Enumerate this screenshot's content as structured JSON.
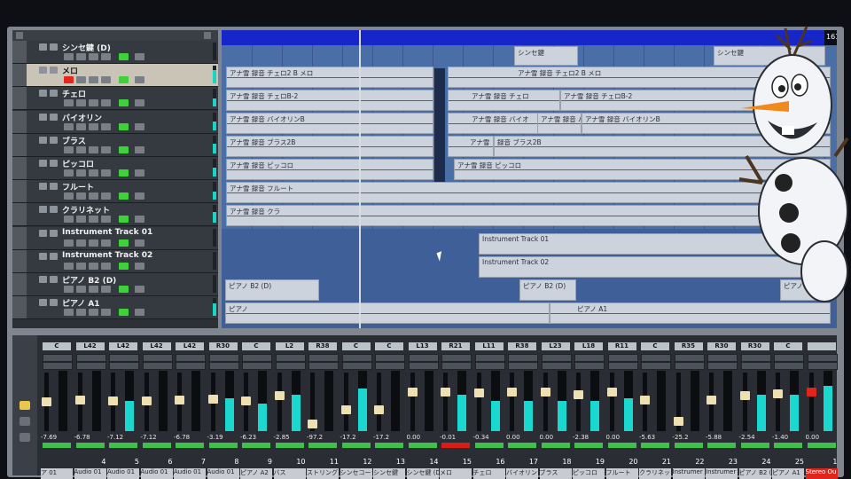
{
  "tracks": [
    {
      "name": "シンセ鍵 (D)",
      "selected": false,
      "rec": false,
      "meter": 0
    },
    {
      "name": "メロ",
      "selected": true,
      "rec": true,
      "meter": 0.75
    },
    {
      "name": "チェロ",
      "selected": false,
      "rec": false,
      "meter": 0.45
    },
    {
      "name": "バイオリン",
      "selected": false,
      "rec": false,
      "meter": 0.5
    },
    {
      "name": "ブラス",
      "selected": false,
      "rec": false,
      "meter": 0.55
    },
    {
      "name": "ピッコロ",
      "selected": false,
      "rec": false,
      "meter": 0.5
    },
    {
      "name": "フルート",
      "selected": false,
      "rec": false,
      "meter": 0.45
    },
    {
      "name": "クラリネット",
      "selected": false,
      "rec": false,
      "meter": 0.6
    },
    {
      "name": "Instrument Track 01",
      "selected": false,
      "rec": false,
      "meter": 0
    },
    {
      "name": "Instrument Track 02",
      "selected": false,
      "rec": false,
      "meter": 0
    },
    {
      "name": "ピアノ B2 (D)",
      "selected": false,
      "rec": false,
      "meter": 0
    },
    {
      "name": "ピアノ A1",
      "selected": false,
      "rec": false,
      "meter": 0.7
    }
  ],
  "ruler": {
    "marker": "161"
  },
  "clips": {
    "synth1": "シンセ鍵",
    "synth2": "シンセ鍵",
    "melo1": "アナ雪  録音  チェロ2 B  メロ",
    "melo2": "アナ雪  録音  チェロ2 B  メロ",
    "cello1": "アナ雪  録音  チェロB-2",
    "cello2": "アナ雪  録音  チェロ",
    "cello3": "アナ雪  録音  チェロB-2",
    "vn1": "アナ雪  録音  バイオリンB",
    "vn2": "アナ雪  録音  バイオ",
    "vn3": "アナ雪  録音  バイオリン",
    "vn4": "アナ雪  録音  バイオリンB",
    "br1": "アナ雪  録音  ブラス2B",
    "br2": "アナ雪",
    "br3": "録音  ブラス2B",
    "pc1": "アナ雪  録音  ピッコロ",
    "pc2": "アナ雪  録音  ピッコロ",
    "fl1": "アナ雪  録音  フルート",
    "cl1": "アナ雪  録音  クラ",
    "inst1": "Instrument Track 01",
    "inst2": "Instrument Track 02",
    "pb1": "ピアノ B2 (D)",
    "pb2": "ピアノ B2 (D)",
    "pb3": "ピアノ",
    "pa1": "ピアノ",
    "pa2": "ピアノ A1"
  },
  "mixer": [
    {
      "pan": "C",
      "value": "-7.69",
      "num": "",
      "name": "ア 01",
      "fader": 0.55,
      "meter": 0,
      "red": false
    },
    {
      "pan": "L42",
      "value": "-6.78",
      "num": "4",
      "name": "Audio 01",
      "fader": 0.58,
      "meter": 0,
      "red": false
    },
    {
      "pan": "L42",
      "value": "-7.12",
      "num": "5",
      "name": "Audio 01",
      "fader": 0.57,
      "meter": 0.5,
      "red": false
    },
    {
      "pan": "L42",
      "value": "-7.12",
      "num": "6",
      "name": "Audio 01",
      "fader": 0.57,
      "meter": 0,
      "red": false
    },
    {
      "pan": "L42",
      "value": "-6.78",
      "num": "7",
      "name": "Audio 01",
      "fader": 0.58,
      "meter": 0,
      "red": false
    },
    {
      "pan": "R30",
      "value": "-3.19",
      "num": "8",
      "name": "Audio 01",
      "fader": 0.6,
      "meter": 0.55,
      "red": false
    },
    {
      "pan": "C",
      "value": "-6.23",
      "num": "9",
      "name": "ピアノ A2",
      "fader": 0.57,
      "meter": 0.45,
      "red": false
    },
    {
      "pan": "L2",
      "value": "-2.85",
      "num": "10",
      "name": "バス",
      "fader": 0.66,
      "meter": 0.6,
      "red": false
    },
    {
      "pan": "R38",
      "value": "-97.2",
      "num": "11",
      "name": "ストリングス",
      "fader": 0.15,
      "meter": 0,
      "red": false
    },
    {
      "pan": "C",
      "value": "-17.2",
      "num": "12",
      "name": "シンセコーラ",
      "fader": 0.4,
      "meter": 0.7,
      "red": false
    },
    {
      "pan": "C",
      "value": "-17.2",
      "num": "13",
      "name": "シンセ鍵",
      "fader": 0.4,
      "meter": 0,
      "red": false
    },
    {
      "pan": "L13",
      "value": "0.00",
      "num": "14",
      "name": "シンセ鍵 (D)",
      "fader": 0.72,
      "meter": 0,
      "red": false
    },
    {
      "pan": "R21",
      "value": "-0.01",
      "num": "15",
      "name": "メロ",
      "fader": 0.72,
      "meter": 0.6,
      "red": true
    },
    {
      "pan": "L11",
      "value": "-0.34",
      "num": "16",
      "name": "チェロ",
      "fader": 0.71,
      "meter": 0.5,
      "red": false
    },
    {
      "pan": "R38",
      "value": "0.00",
      "num": "17",
      "name": "バイオリン",
      "fader": 0.72,
      "meter": 0.5,
      "red": false
    },
    {
      "pan": "L23",
      "value": "0.00",
      "num": "18",
      "name": "ブラス",
      "fader": 0.72,
      "meter": 0.5,
      "red": false
    },
    {
      "pan": "L18",
      "value": "-2.38",
      "num": "19",
      "name": "ピッコロ",
      "fader": 0.67,
      "meter": 0.5,
      "red": false
    },
    {
      "pan": "R11",
      "value": "0.00",
      "num": "20",
      "name": "フルート",
      "fader": 0.72,
      "meter": 0.55,
      "red": false
    },
    {
      "pan": "C",
      "value": "-5.63",
      "num": "21",
      "name": "クラリネット",
      "fader": 0.58,
      "meter": 0,
      "red": false
    },
    {
      "pan": "R35",
      "value": "-25.2",
      "num": "22",
      "name": "Instrumer",
      "fader": 0.2,
      "meter": 0,
      "red": false
    },
    {
      "pan": "R30",
      "value": "-5.88",
      "num": "23",
      "name": "Instrumer",
      "fader": 0.58,
      "meter": 0,
      "red": false
    },
    {
      "pan": "R30",
      "value": "-2.54",
      "num": "24",
      "name": "ピアノ B2 (",
      "fader": 0.66,
      "meter": 0.6,
      "red": false
    },
    {
      "pan": "C",
      "value": "-1.40",
      "num": "25",
      "name": "ピアノ A1",
      "fader": 0.7,
      "meter": 0.6,
      "red": false
    },
    {
      "pan": "",
      "value": "0.00",
      "num": "1",
      "name": "Stereo Ou",
      "fader": 0.72,
      "meter": 0.75,
      "red": true
    }
  ]
}
